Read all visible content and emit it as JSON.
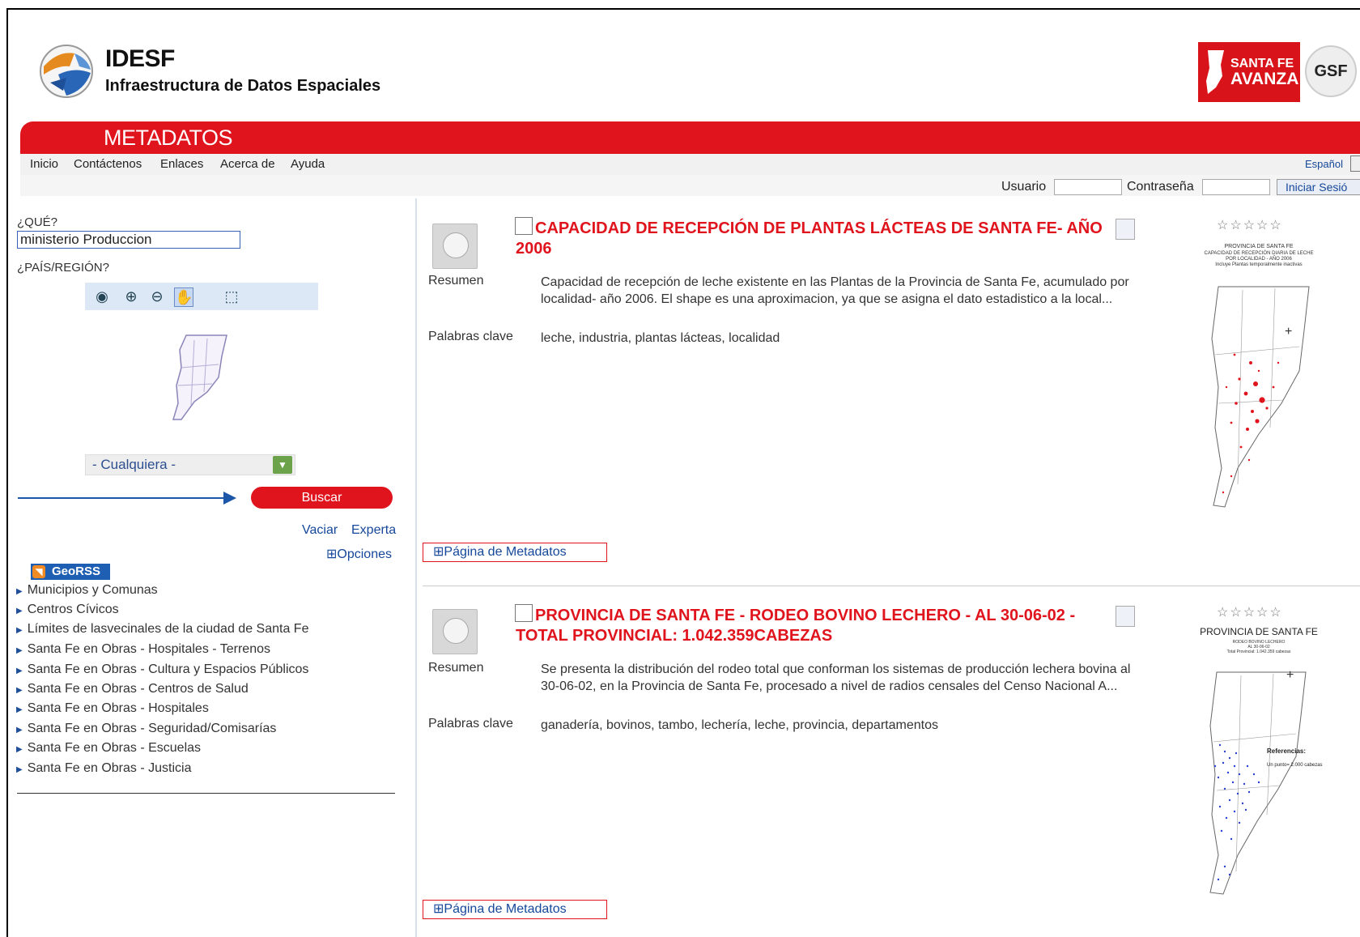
{
  "header": {
    "brand_title": "IDESF",
    "brand_subtitle": "Infraestructura de Datos Espaciales",
    "logo_santafe_line1": "SANTA FE",
    "logo_santafe_line2": "AVANZA",
    "logo_gsf": "GSF",
    "section_title": "METADATOS"
  },
  "nav": {
    "items": [
      "Inicio",
      "Contáctenos",
      "Enlaces",
      "Acerca de",
      "Ayuda"
    ],
    "language": "Español"
  },
  "login": {
    "user_label": "Usuario",
    "password_label": "Contraseña",
    "button": "Iniciar Sesió"
  },
  "search": {
    "what_label": "¿QUÉ?",
    "what_value": "ministerio Produccion",
    "region_label": "¿PAÍS/REGIÓN?",
    "region_select": "- Cualquiera -",
    "search_button": "Buscar",
    "clear_link": "Vaciar",
    "expert_link": "Experta",
    "options_link": "⊞Opciones"
  },
  "georss": {
    "label": "GeoRSS",
    "feeds": [
      "Municipios y Comunas",
      "Centros Cívicos",
      "Límites de lasvecinales de la ciudad de Santa Fe",
      "Santa Fe en Obras - Hospitales - Terrenos",
      "Santa Fe en Obras - Cultura y Espacios Públicos",
      "Santa Fe en Obras - Centros de Salud",
      "Santa Fe en Obras - Hospitales",
      "Santa Fe en Obras - Seguridad/Comisarías",
      "Santa Fe en Obras - Escuelas",
      "Santa Fe en Obras - Justicia"
    ]
  },
  "results": [
    {
      "title_line1": "CAPACIDAD DE RECEPCIÓN DE PLANTAS LÁCTEAS DE SANTA FE- AÑO",
      "title_line2": "2006",
      "summary_label": "Resumen",
      "summary": "Capacidad de recepción de leche existente en las Plantas de la Provincia de Santa Fe, acumulado por localidad- año 2006. El shape es una aproximacion, ya que se asigna el dato estadistico a la local...",
      "keywords_label": "Palabras clave",
      "keywords": "leche, industria, plantas lácteas, localidad",
      "stars": "☆☆☆☆☆",
      "thumb_title": "PROVINCIA DE SANTA FE",
      "thumb_sub1": "CAPACIDAD DE RECEPCIÓN DIARIA DE LECHE",
      "thumb_sub2": "POR LOCALIDAD - AÑO 2006",
      "thumb_sub3": "Incluye Plantas temporalmente inactivas",
      "meta_button": "Página de Metadatos"
    },
    {
      "title_line1": "PROVINCIA DE SANTA FE - RODEO BOVINO LECHERO - AL 30-06-02 -",
      "title_line2": "TOTAL PROVINCIAL: 1.042.359CABEZAS",
      "summary_label": "Resumen",
      "summary": "Se presenta la distribución del rodeo total que conforman los sistemas de producción lechera bovina al 30-06-02, en la Provincia de Santa Fe, procesado a nivel de radios censales del Censo Nacional A...",
      "keywords_label": "Palabras clave",
      "keywords": "ganadería, bovinos, tambo, lechería, leche, provincia, departamentos",
      "stars": "☆☆☆☆☆",
      "thumb_title": "PROVINCIA DE SANTA FE",
      "thumb_sub1": "RODEO BOVINO LECHERO",
      "thumb_sub2": "AL 30-06-02",
      "thumb_sub3": "Total Provincial: 1.042.359 cabezas",
      "thumb_ref": "Referencias:",
      "thumb_ref2": "Un punto= 2.000 cabezas",
      "meta_button": "Página de Metadatos"
    }
  ],
  "colors": {
    "accent_red": "#e0141d",
    "link_blue": "#15479a"
  }
}
